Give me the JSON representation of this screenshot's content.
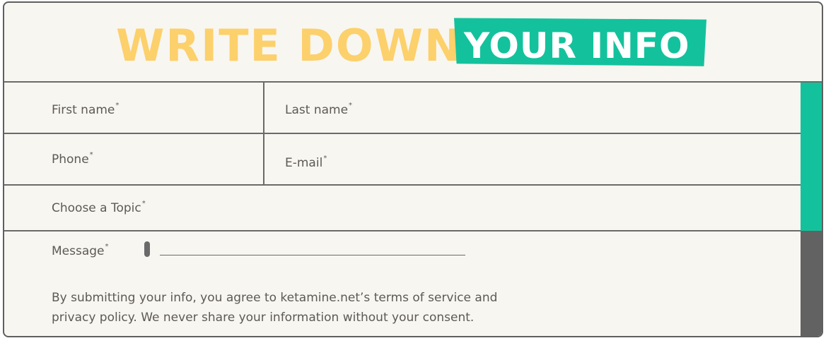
{
  "header": {
    "title_part1": "WRITE DOWN",
    "title_part2": "YOUR INFO"
  },
  "form": {
    "first_name": {
      "label": "First name",
      "required_mark": "*"
    },
    "last_name": {
      "label": "Last name",
      "required_mark": "*"
    },
    "phone": {
      "label": "Phone",
      "required_mark": "*"
    },
    "email": {
      "label": "E-mail",
      "required_mark": "*"
    },
    "topic": {
      "label": "Choose a Topic",
      "required_mark": "*"
    },
    "message": {
      "label": "Message",
      "required_mark": "*",
      "value": ""
    }
  },
  "consent_text": "By submitting your info, you agree to ketamine.net’s terms of service and privacy policy. We never share your information without your consent.",
  "colors": {
    "background": "#f8f6f1",
    "title_yellow": "#fcd06b",
    "accent_green": "#13c29c",
    "border_gray": "#6a6a6a",
    "text": "#5d5a56"
  }
}
